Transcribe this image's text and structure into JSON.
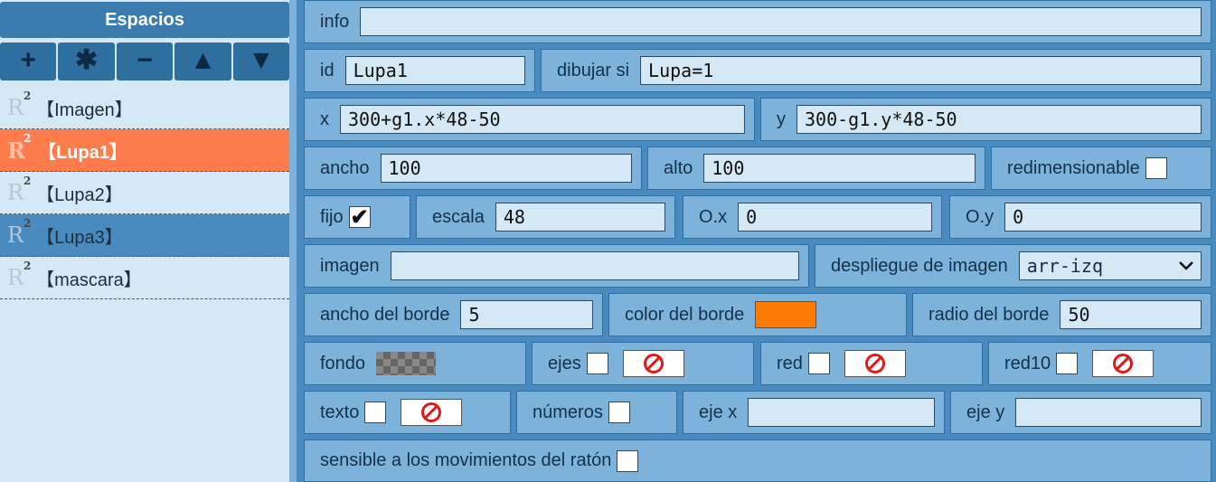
{
  "sidebar": {
    "title": "Espacios",
    "toolbar": [
      "+",
      "✱",
      "−",
      "▲",
      "▼"
    ],
    "space_icon": "R",
    "space_icon_sup": "2",
    "items": [
      {
        "label": "【Imagen】"
      },
      {
        "label": "【Lupa1】"
      },
      {
        "label": "【Lupa2】"
      },
      {
        "label": "【Lupa3】"
      },
      {
        "label": "【mascara】"
      }
    ]
  },
  "fields": {
    "info": {
      "label": "info",
      "value": ""
    },
    "id": {
      "label": "id",
      "value": "Lupa1"
    },
    "dibujar_si": {
      "label": "dibujar si",
      "value": "Lupa=1"
    },
    "x": {
      "label": "x",
      "value": "300+g1.x*48-50"
    },
    "y": {
      "label": "y",
      "value": "300-g1.y*48-50"
    },
    "ancho": {
      "label": "ancho",
      "value": "100"
    },
    "alto": {
      "label": "alto",
      "value": "100"
    },
    "redimensionable": {
      "label": "redimensionable"
    },
    "fijo": {
      "label": "fijo",
      "check": "✔"
    },
    "escala": {
      "label": "escala",
      "value": "48"
    },
    "ox": {
      "label": "O.x",
      "value": "0"
    },
    "oy": {
      "label": "O.y",
      "value": "0"
    },
    "imagen": {
      "label": "imagen",
      "value": ""
    },
    "despliegue": {
      "label": "despliegue de imagen",
      "value": "arr-izq"
    },
    "ancho_borde": {
      "label": "ancho del borde",
      "value": "5"
    },
    "color_borde": {
      "label": "color del borde",
      "color": "#ff7a00"
    },
    "radio_borde": {
      "label": "radio del borde",
      "value": "50"
    },
    "fondo": {
      "label": "fondo"
    },
    "ejes": {
      "label": "ejes"
    },
    "red": {
      "label": "red"
    },
    "red10": {
      "label": "red10"
    },
    "texto": {
      "label": "texto"
    },
    "numeros": {
      "label": "números"
    },
    "eje_x": {
      "label": "eje x",
      "value": ""
    },
    "eje_y": {
      "label": "eje y",
      "value": ""
    },
    "sensible": {
      "label": "sensible a los movimientos del ratón"
    }
  }
}
